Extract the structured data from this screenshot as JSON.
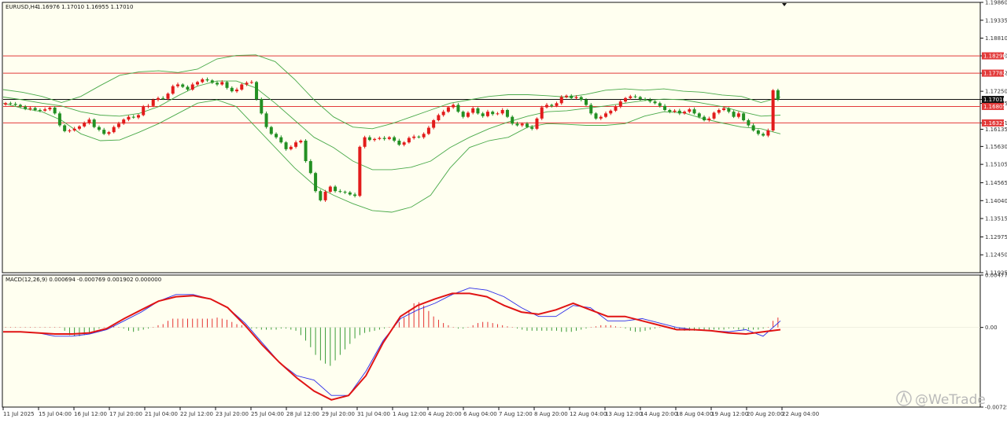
{
  "header": {
    "symbol": "EURUSD,H4",
    "ohlc": "1.16976 1.17010 1.16955 1.17010"
  },
  "watermark": {
    "text": "@WeTrade"
  },
  "colors": {
    "background": "#fffff0",
    "bull": "#e21b1b",
    "bear": "#239023",
    "bands": "#49a949",
    "level": "#e23a3a",
    "macd_line": "#2a2ae8",
    "signal_line": "#e01414"
  },
  "chart_data": [
    {
      "type": "candlestick",
      "title": "EURUSD,H4",
      "ylim": [
        1.11925,
        1.1986
      ],
      "y_ticks": [
        "1.19860",
        "1.19335",
        "1.18810",
        "1.18290",
        "1.17782",
        "1.17250",
        "1.16895",
        "1.16321",
        "1.16135",
        "1.15630",
        "1.15105",
        "1.14565",
        "1.14040",
        "1.13515",
        "1.12975",
        "1.12450",
        "1.11925"
      ],
      "x_labels": [
        "11 Jul 2025",
        "15 Jul 04:00",
        "16 Jul 12:00",
        "17 Jul 20:00",
        "21 Jul 04:00",
        "22 Jul 12:00",
        "23 Jul 20:00",
        "25 Jul 04:00",
        "28 Jul 12:00",
        "29 Jul 20:00",
        "31 Jul 04:00",
        "1 Aug 12:00",
        "4 Aug 20:00",
        "6 Aug 04:00",
        "7 Aug 12:00",
        "8 Aug 20:00",
        "12 Aug 04:00",
        "13 Aug 12:00",
        "14 Aug 20:00",
        "18 Aug 04:00",
        "19 Aug 12:00",
        "20 Aug 20:00",
        "22 Aug 04:00"
      ],
      "horizontal_levels": [
        {
          "value": 1.1829,
          "label": "1.18290",
          "style": "red"
        },
        {
          "value": 1.17782,
          "label": "1.17782",
          "style": "red"
        },
        {
          "value": 1.1701,
          "label": "1.17010",
          "style": "black"
        },
        {
          "value": 1.16805,
          "label": "1.16805",
          "style": "red"
        },
        {
          "value": 1.16321,
          "label": "1.16321",
          "style": "red"
        }
      ],
      "current_price": 1.1701,
      "series": [
        {
          "name": "",
          "kind": "close",
          "values": [
            1.169,
            1.1688,
            1.1685,
            1.168,
            1.1673,
            1.1676,
            1.167,
            1.1668,
            1.1672,
            1.1677,
            1.166,
            1.1625,
            1.1608,
            1.161,
            1.1615,
            1.1622,
            1.1632,
            1.1642,
            1.162,
            1.1612,
            1.16,
            1.1605,
            1.162,
            1.163,
            1.1642,
            1.165,
            1.1648,
            1.1655,
            1.168,
            1.1682,
            1.17,
            1.1705,
            1.1703,
            1.1718,
            1.174,
            1.1745,
            1.1738,
            1.173,
            1.1745,
            1.1752,
            1.176,
            1.1757,
            1.175,
            1.1745,
            1.1752,
            1.1735,
            1.1725,
            1.173,
            1.1745,
            1.175,
            1.1752,
            1.1702,
            1.166,
            1.162,
            1.16,
            1.159,
            1.1575,
            1.1555,
            1.1562,
            1.1575,
            1.158,
            1.152,
            1.1485,
            1.1432,
            1.1405,
            1.143,
            1.1445,
            1.1432,
            1.143,
            1.1428,
            1.1422,
            1.1418,
            1.1562,
            1.159,
            1.1582,
            1.1585,
            1.1588,
            1.1585,
            1.159,
            1.158,
            1.1568,
            1.1575,
            1.1588,
            1.1592,
            1.159,
            1.16,
            1.1618,
            1.164,
            1.1655,
            1.1665,
            1.1678,
            1.1685,
            1.1665,
            1.165,
            1.1662,
            1.1675,
            1.166,
            1.1652,
            1.1665,
            1.1658,
            1.166,
            1.167,
            1.165,
            1.163,
            1.1625,
            1.163,
            1.162,
            1.1615,
            1.1645,
            1.1678,
            1.1685,
            1.1682,
            1.169,
            1.1708,
            1.1712,
            1.1705,
            1.1708,
            1.17,
            1.1685,
            1.166,
            1.1645,
            1.165,
            1.166,
            1.1668,
            1.168,
            1.1695,
            1.1705,
            1.171,
            1.1708,
            1.1702,
            1.17,
            1.1695,
            1.169,
            1.1682,
            1.167,
            1.1665,
            1.1668,
            1.166,
            1.1665,
            1.1672,
            1.166,
            1.165,
            1.164,
            1.1645,
            1.1662,
            1.167,
            1.1675,
            1.1665,
            1.165,
            1.166,
            1.164,
            1.1625,
            1.161,
            1.16,
            1.1595,
            1.161,
            1.1728,
            1.1701
          ]
        },
        {
          "name": "",
          "kind": "bollinger_upper",
          "values": [
            1.173,
            1.1722,
            1.171,
            1.1692,
            1.171,
            1.1742,
            1.1772,
            1.1782,
            1.1785,
            1.178,
            1.179,
            1.182,
            1.183,
            1.1832,
            1.1812,
            1.176,
            1.17,
            1.165,
            1.162,
            1.1615,
            1.163,
            1.165,
            1.167,
            1.169,
            1.17,
            1.171,
            1.1715,
            1.1715,
            1.1712,
            1.1708,
            1.1716,
            1.1728,
            1.1732,
            1.1728,
            1.1732,
            1.1725,
            1.1722,
            1.1714,
            1.171,
            1.1692,
            1.1708
          ]
        },
        {
          "name": "",
          "kind": "bollinger_middle",
          "values": [
            1.1708,
            1.17,
            1.169,
            1.1682,
            1.1665,
            1.1655,
            1.1652,
            1.166,
            1.168,
            1.1712,
            1.174,
            1.1755,
            1.1755,
            1.1735,
            1.169,
            1.164,
            1.159,
            1.156,
            1.152,
            1.1495,
            1.1495,
            1.1502,
            1.152,
            1.156,
            1.159,
            1.1615,
            1.1635,
            1.1652,
            1.1665,
            1.1668,
            1.1675,
            1.1682,
            1.169,
            1.1698,
            1.1702,
            1.17,
            1.169,
            1.168,
            1.1665,
            1.1652,
            1.1655
          ]
        },
        {
          "name": "",
          "kind": "bollinger_lower",
          "values": [
            1.169,
            1.1675,
            1.1665,
            1.164,
            1.16,
            1.158,
            1.1582,
            1.1605,
            1.163,
            1.166,
            1.169,
            1.17,
            1.168,
            1.162,
            1.156,
            1.15,
            1.145,
            1.142,
            1.1395,
            1.1375,
            1.137,
            1.1385,
            1.142,
            1.15,
            1.156,
            1.158,
            1.159,
            1.162,
            1.163,
            1.1628,
            1.1625,
            1.1625,
            1.163,
            1.1652,
            1.1665,
            1.1662,
            1.1645,
            1.1632,
            1.162,
            1.1615,
            1.16
          ]
        }
      ]
    },
    {
      "type": "macd",
      "title": "MACD(12,26,9) 0.000694 -0.000769 0.001902 0.000000",
      "ylim": [
        -0.007257,
        0.004774
      ],
      "y_ticks": [
        "0.004774",
        "0.00",
        "-0.007257"
      ],
      "series": [
        {
          "name": "",
          "kind": "histogram",
          "values": [
            0.0,
            0.0,
            0.0,
            0.0,
            0.0,
            0.0,
            0.0,
            0.0,
            0.0,
            0.0,
            0.0,
            0.0,
            -0.0003,
            -0.0007,
            -0.0008,
            -0.0008,
            -0.0007,
            -0.0005,
            -0.0003,
            -0.0001,
            0.0,
            0.0,
            0.0001,
            0.0,
            -0.0001,
            -0.0003,
            -0.0004,
            -0.0003,
            -0.0002,
            -0.0001,
            0.0,
            0.0002,
            0.0003,
            0.0006,
            0.0008,
            0.0008,
            0.0008,
            0.0008,
            0.0008,
            0.0008,
            0.0008,
            0.0008,
            0.0008,
            0.0009,
            0.0008,
            0.0007,
            0.0005,
            0.0003,
            0.0002,
            0.0001,
            -0.0001,
            -0.0001,
            -0.0002,
            -0.0002,
            -0.0002,
            -0.0002,
            -0.0001,
            -0.0001,
            -0.0002,
            -0.0003,
            -0.0007,
            -0.0012,
            -0.0018,
            -0.0025,
            -0.003,
            -0.0033,
            -0.0035,
            -0.003,
            -0.0025,
            -0.002,
            -0.0015,
            -0.001,
            -0.0007,
            -0.0005,
            -0.0004,
            -0.0003,
            -0.0002,
            -0.0001,
            0.0,
            0.0002,
            0.0005,
            0.0009,
            0.0016,
            0.0022,
            0.0023,
            0.002,
            0.0015,
            0.001,
            0.0007,
            0.0004,
            0.0002,
            0.0,
            -0.0001,
            -0.0001,
            0.0,
            0.0002,
            0.0004,
            0.0005,
            0.0005,
            0.0004,
            0.0003,
            0.0002,
            0.0001,
            0.0,
            -0.0001,
            -0.0002,
            -0.0003,
            -0.0003,
            -0.0003,
            -0.0003,
            -0.0003,
            -0.0003,
            -0.0003,
            -0.0004,
            -0.0004,
            -0.0004,
            -0.0003,
            -0.0002,
            -0.0001,
            0.0,
            0.0001,
            0.0002,
            0.0002,
            0.0002,
            0.0001,
            0.0,
            -0.0001,
            -0.0003,
            -0.0004,
            -0.0004,
            -0.0003,
            -0.0002,
            -0.0001,
            0.0,
            0.0,
            -0.0001,
            -0.0002,
            -0.0002,
            -0.0003,
            -0.0003,
            -0.0003,
            -0.0002,
            -0.0002,
            -0.0002,
            -0.0002,
            -0.0002,
            -0.0002,
            -0.0001,
            -0.0001,
            -0.0002,
            -0.0002,
            -0.0002,
            -0.0002,
            -0.0002,
            -0.0001,
            0.0,
            0.0006,
            0.0009
          ]
        },
        {
          "name": "",
          "kind": "macd",
          "values": [
            -0.0004,
            -0.0004,
            -0.0005,
            -0.0008,
            -0.0008,
            -0.0006,
            -0.0002,
            0.0006,
            0.0014,
            0.0024,
            0.003,
            0.003,
            0.0026,
            0.0018,
            0.0004,
            -0.0014,
            -0.0032,
            -0.0044,
            -0.0048,
            -0.0062,
            -0.0062,
            -0.004,
            -0.0012,
            0.0008,
            0.0016,
            0.0022,
            0.003,
            0.0036,
            0.0034,
            0.0028,
            0.0018,
            0.001,
            0.001,
            0.002,
            0.0018,
            0.0006,
            0.0006,
            0.0008,
            0.0004,
            0.0,
            -0.0002,
            -0.0003,
            -0.0004,
            -0.0002,
            -0.0008,
            0.0006
          ]
        },
        {
          "name": "",
          "kind": "signal",
          "values": [
            -0.0004,
            -0.0004,
            -0.0005,
            -0.0006,
            -0.0006,
            -0.0005,
            -0.0001,
            0.0008,
            0.0016,
            0.0024,
            0.0028,
            0.0029,
            0.0026,
            0.0018,
            0.0002,
            -0.0016,
            -0.0032,
            -0.0046,
            -0.0058,
            -0.0066,
            -0.0062,
            -0.0044,
            -0.0014,
            0.001,
            0.002,
            0.0026,
            0.0031,
            0.0031,
            0.0028,
            0.002,
            0.0014,
            0.0012,
            0.0016,
            0.0022,
            0.0016,
            0.001,
            0.001,
            0.0006,
            0.0002,
            -0.0002,
            -0.0002,
            -0.0003,
            -0.0005,
            -0.0006,
            -0.0004,
            -0.0002
          ]
        }
      ]
    }
  ]
}
